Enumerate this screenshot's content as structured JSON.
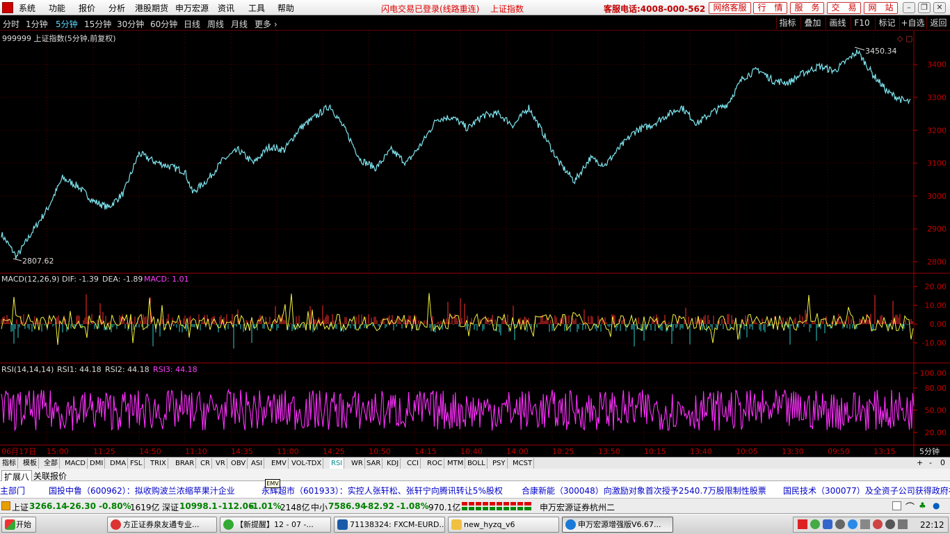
{
  "menu": {
    "items": [
      "系统",
      "功能",
      "报价",
      "分析",
      "港股期货",
      "申万宏源",
      "资讯",
      "工具",
      "帮助"
    ],
    "status": "闪电交易已登录(线路重连)",
    "index_name": "上证指数",
    "hotline": "客服电话:4008-000-562",
    "buttons": [
      "网络客服",
      "行　情",
      "服　务",
      "交　易",
      "网　站"
    ]
  },
  "periods": [
    "分时",
    "1分钟",
    "5分钟",
    "15分钟",
    "30分钟",
    "60分钟",
    "日线",
    "周线",
    "月线",
    "更多 ›"
  ],
  "period_selected": "5分钟",
  "tools": [
    "指标",
    "叠加",
    "画线",
    "F10",
    "标记",
    "+自选",
    "返回"
  ],
  "main": {
    "title": "999999 上证指数(5分钟,前复权)",
    "high_label": "3450.34",
    "low_label": "2807.62",
    "y_ticks": [
      "3400",
      "3300",
      "3200",
      "3100",
      "3000",
      "2900",
      "2800"
    ],
    "y_values": [
      3400,
      3300,
      3200,
      3100,
      3000,
      2900,
      2800
    ],
    "ylim": [
      2780,
      3465
    ]
  },
  "macd": {
    "title": "MACD(12,26,9)",
    "dif": "DIF: -1.39",
    "dea": "DEA: -1.89",
    "macd": "MACD: 1.01",
    "y_ticks": [
      "20.00",
      "10.00",
      "0.00",
      "-10.00"
    ],
    "y_values": [
      20,
      10,
      0,
      -10
    ],
    "ylim": [
      -20,
      26
    ]
  },
  "rsi": {
    "title": "RSI(14,14,14)",
    "rsi1": "RSI1: 44.18",
    "rsi2": "RSI2: 44.18",
    "rsi3": "RSI3: 44.18",
    "y_ticks": [
      "100.00",
      "80.00",
      "50.00",
      "20.00"
    ],
    "y_values": [
      100,
      80,
      50,
      20
    ],
    "ylim": [
      5,
      110
    ]
  },
  "x_labels": [
    "06月17日",
    "15:00",
    "11:25",
    "14:50",
    "11:10",
    "14:35",
    "11:00",
    "14:25",
    "10:50",
    "14:15",
    "10:40",
    "14:00",
    "10:25",
    "13:50",
    "10:15",
    "13:40",
    "10:05",
    "13:30",
    "09:50",
    "13:15"
  ],
  "x_period": "5分钟",
  "chart_data": {
    "type": "line",
    "title": "999999 上证指数(5分钟,前复权)",
    "series": [
      {
        "name": "上证指数",
        "points": [
          [
            0,
            2885
          ],
          [
            2,
            2815
          ],
          [
            4,
            2890
          ],
          [
            6,
            2960
          ],
          [
            8,
            3055
          ],
          [
            10,
            3030
          ],
          [
            12,
            2985
          ],
          [
            14,
            2965
          ],
          [
            16,
            3010
          ],
          [
            18,
            3130
          ],
          [
            20,
            3105
          ],
          [
            22,
            3090
          ],
          [
            24,
            3075
          ],
          [
            25,
            3010
          ],
          [
            27,
            3050
          ],
          [
            29,
            3110
          ],
          [
            31,
            3140
          ],
          [
            33,
            3100
          ],
          [
            35,
            3150
          ],
          [
            37,
            3140
          ],
          [
            39,
            3205
          ],
          [
            41,
            3240
          ],
          [
            43,
            3275
          ],
          [
            45,
            3200
          ],
          [
            47,
            3110
          ],
          [
            49,
            3085
          ],
          [
            51,
            3140
          ],
          [
            53,
            3100
          ],
          [
            55,
            3160
          ],
          [
            57,
            3235
          ],
          [
            59,
            3240
          ],
          [
            61,
            3205
          ],
          [
            63,
            3245
          ],
          [
            65,
            3250
          ],
          [
            67,
            3215
          ],
          [
            69,
            3270
          ],
          [
            71,
            3185
          ],
          [
            73,
            3100
          ],
          [
            75,
            3045
          ],
          [
            77,
            3115
          ],
          [
            79,
            3095
          ],
          [
            81,
            3150
          ],
          [
            83,
            3200
          ],
          [
            85,
            3215
          ],
          [
            87,
            3245
          ],
          [
            89,
            3270
          ],
          [
            91,
            3220
          ],
          [
            93,
            3255
          ],
          [
            95,
            3280
          ],
          [
            97,
            3360
          ],
          [
            99,
            3385
          ],
          [
            101,
            3350
          ],
          [
            103,
            3345
          ],
          [
            105,
            3375
          ],
          [
            107,
            3395
          ],
          [
            109,
            3380
          ],
          [
            111,
            3420
          ],
          [
            112,
            3440
          ],
          [
            114,
            3370
          ],
          [
            116,
            3315
          ],
          [
            118,
            3290
          ],
          [
            119,
            3285
          ]
        ]
      }
    ],
    "xlabel": "",
    "ylabel": ""
  },
  "indicators": [
    "指标",
    "模板",
    "全部",
    "MACD",
    "DMI",
    "DMA",
    "FSL",
    "TRIX",
    "BRAR",
    "CR",
    "VR",
    "OBV",
    "ASI",
    "EMV",
    "VOL-TDX",
    "RSI",
    "WR",
    "SAR",
    "KDJ",
    "CCI",
    "ROC",
    "MTM",
    "BOLL",
    "PSY",
    "MCST"
  ],
  "indicator_selected": "RSI",
  "ext": [
    "扩展八",
    "关联报价"
  ],
  "tooltip": "EMV",
  "ticker": [
    "主部门",
    "国投中鲁（600962）：拟收购波兰浓缩苹果汁企业",
    "永辉超市（601933）：实控人张轩松、张轩宁向腾讯转让5%股权",
    "合康新能（300048）向激励对象首次授予2540.7万股限制性股票",
    "国民技术（300077）及全资子公司获得政府补"
  ],
  "status": {
    "sh_name": "上证",
    "sh_val": "3266.14",
    "sh_chg": "-26.30",
    "sh_pct": "-0.80%",
    "sh_amt": "1619亿",
    "sz_name": "深证",
    "sz_val": "10998.1",
    "sz_chg": "-112.06",
    "sz_pct": "-1.01%",
    "sz_amt": "2148亿",
    "zx_name": "中小",
    "zx_val": "7586.94",
    "zx_chg": "-82.92",
    "zx_pct": "-1.08%",
    "zx_amt": "970.1亿",
    "broker": "申万宏源证券杭州二"
  },
  "taskbar": {
    "start": "开始",
    "tasks": [
      "方正证券泉友通专业...",
      "【新提醒】12 - 07 -...",
      "71138324: FXCM-EURD...",
      "new_hyzq_v6",
      "申万宏源增强版V6.67..."
    ],
    "clock": "22:12"
  },
  "colors": {
    "price": "#7fe6f0",
    "axis": "#c00000",
    "macd_pos": "#ff3030",
    "macd_neg": "#30d0d0",
    "dif": "#f0f040",
    "rsi": "#ff30ff"
  }
}
